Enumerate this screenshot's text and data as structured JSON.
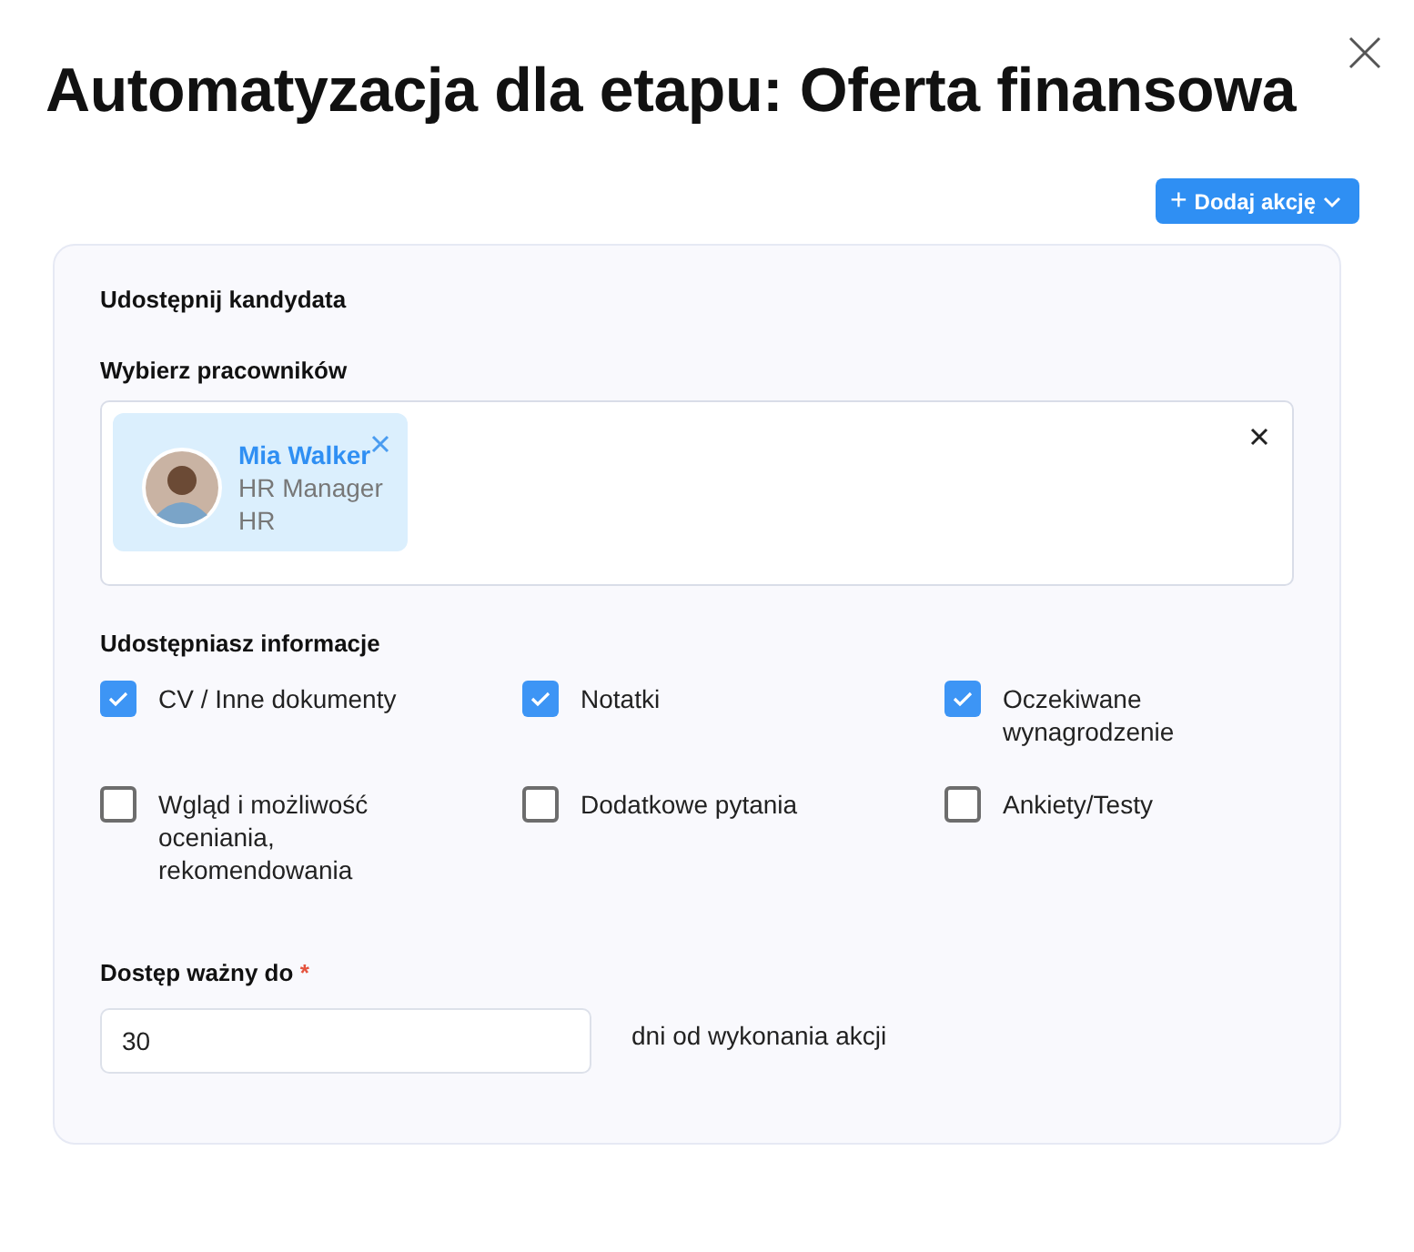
{
  "title": "Automatyzacja dla etapu: Oferta finansowa",
  "add_action_button": {
    "icon": "+",
    "label": "Dodaj akcję"
  },
  "card": {
    "heading": "Udostępnij kandydata",
    "employees": {
      "label": "Wybierz pracowników",
      "selected": [
        {
          "name": "Mia Walker",
          "role": "HR Manager",
          "department": "HR"
        }
      ]
    },
    "info": {
      "label": "Udostępniasz informacje",
      "options": [
        {
          "label": "CV / Inne dokumenty",
          "checked": true
        },
        {
          "label": "Notatki",
          "checked": true
        },
        {
          "label": "Oczekiwane wynagrodzenie",
          "checked": true
        },
        {
          "label": "Wgląd i możliwość oceniania, rekomendowania",
          "checked": false
        },
        {
          "label": "Dodatkowe pytania",
          "checked": false
        },
        {
          "label": "Ankiety/Testy",
          "checked": false
        }
      ]
    },
    "access": {
      "label": "Dostęp ważny do",
      "required_mark": "*",
      "value": "30",
      "suffix": "dni od wykonania akcji"
    }
  }
}
